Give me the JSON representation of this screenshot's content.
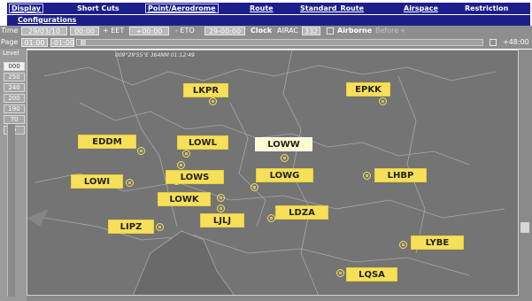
{
  "menu": {
    "items": [
      "Display",
      "Short Cuts",
      "Point/Aerodrome",
      "Route",
      "Standard_Route",
      "Airspace",
      "Restriction"
    ],
    "configurations": "Configurations"
  },
  "timebar": {
    "time_label": "Time",
    "date": "29/03/10",
    "time": "00:00",
    "eet_label": "+ EET",
    "eet_value": "+00:00",
    "eto_label": "- ETO",
    "eto_value": "29-00:00",
    "clock_label": "Clock",
    "airac_label": "AIRAC",
    "airac_value": "332",
    "airborne_label": "Airborne",
    "before_label": "Before",
    "before_value": "+"
  },
  "pagebar": {
    "page_label": "Page",
    "page_forward": "01:00",
    "page_back": "-01:00",
    "range_value": "+48:00"
  },
  "levels": {
    "title": "Level",
    "items": [
      "000",
      "250",
      "240",
      "200",
      "190",
      "70",
      "0"
    ],
    "selected": "000"
  },
  "map": {
    "coordinate_readout": "009°29'55\"E    364NM 01:12:49",
    "aerodromes": [
      "LKPR",
      "EPKK",
      "EDDM",
      "LOWL",
      "LOWW",
      "LOWI",
      "LOWS",
      "LOWG",
      "LHBP",
      "LOWK",
      "LDZA",
      "LIPZ",
      "LJLJ",
      "LYBE",
      "LQSA"
    ],
    "selected_aerodrome": "LOWW"
  },
  "colors": {
    "menubar": "#1c1f8a",
    "map_background": "#747474",
    "aerodrome_label": "#f6e05a",
    "selected_aerodrome_label": "#fffbd0"
  }
}
